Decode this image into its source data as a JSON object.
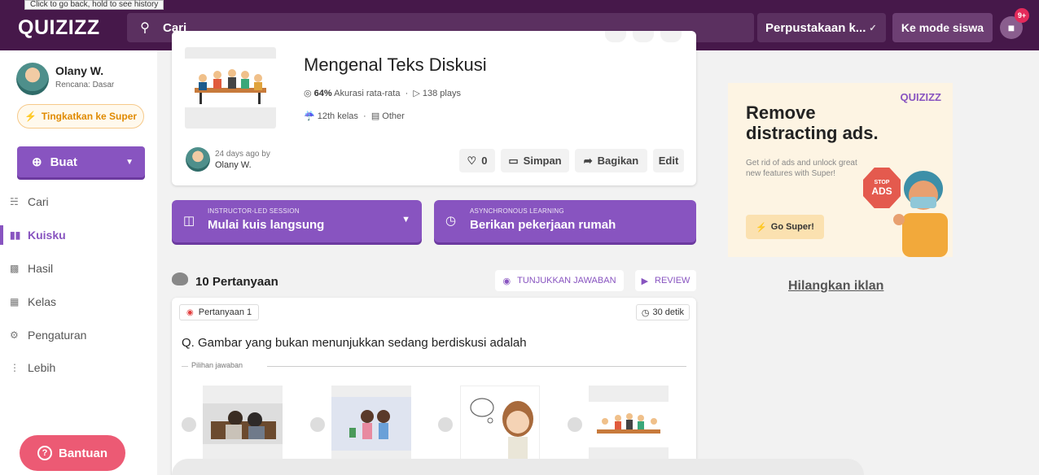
{
  "browser": {
    "tooltip": "Click to go back, hold to see history"
  },
  "header": {
    "logo": "QUIZIZZ",
    "search_placeholder": "Cari",
    "library_select": "Perpustakaan k...",
    "student_mode": "Ke mode siswa",
    "gift_badge": "9+"
  },
  "sidebar": {
    "user_name": "Olany W.",
    "plan": "Rencana: Dasar",
    "upgrade": "Tingkatkan ke Super",
    "create": "Buat",
    "items": [
      {
        "label": "Cari",
        "icon": "search-icon"
      },
      {
        "label": "Kuisku",
        "icon": "library-icon"
      },
      {
        "label": "Hasil",
        "icon": "reports-icon"
      },
      {
        "label": "Kelas",
        "icon": "classes-icon"
      },
      {
        "label": "Pengaturan",
        "icon": "gear-icon"
      },
      {
        "label": "Lebih",
        "icon": "more-icon"
      }
    ],
    "help": "Bantuan"
  },
  "quiz": {
    "title": "Mengenal Teks Diskusi",
    "accuracy": "64%",
    "accuracy_label": "Akurasi rata-rata",
    "plays": "138 plays",
    "grade": "12th kelas",
    "subject": "Other",
    "created_time": "24 days ago by",
    "author": "Olany W.",
    "likes": "0",
    "save": "Simpan",
    "share": "Bagikan",
    "edit": "Edit"
  },
  "sessions": {
    "live_small": "INSTRUCTOR-LED SESSION",
    "live_big": "Mulai kuis langsung",
    "async_small": "ASYNCHRONOUS LEARNING",
    "async_big": "Berikan pekerjaan rumah"
  },
  "questions": {
    "count_label": "10 Pertanyaan",
    "show_answers": "TUNJUKKAN JAWABAN",
    "review": "REVIEW",
    "first": {
      "tag": "Pertanyaan 1",
      "time": "30 detik",
      "text": "Q. Gambar yang bukan menunjukkan sedang berdiskusi adalah",
      "choices_label": "Pilihan jawaban"
    }
  },
  "ad": {
    "logo": "QUIZIZZ",
    "headline": "Remove distracting ads.",
    "body": "Get rid of ads and unlock great new features with Super!",
    "cta": "Go Super!",
    "stop_small": "STOP",
    "stop_big": "ADS",
    "remove_link": "Hilangkan iklan"
  },
  "colors": {
    "primary": "#8854c0",
    "header": "#46184a",
    "help": "#ec5a74"
  }
}
